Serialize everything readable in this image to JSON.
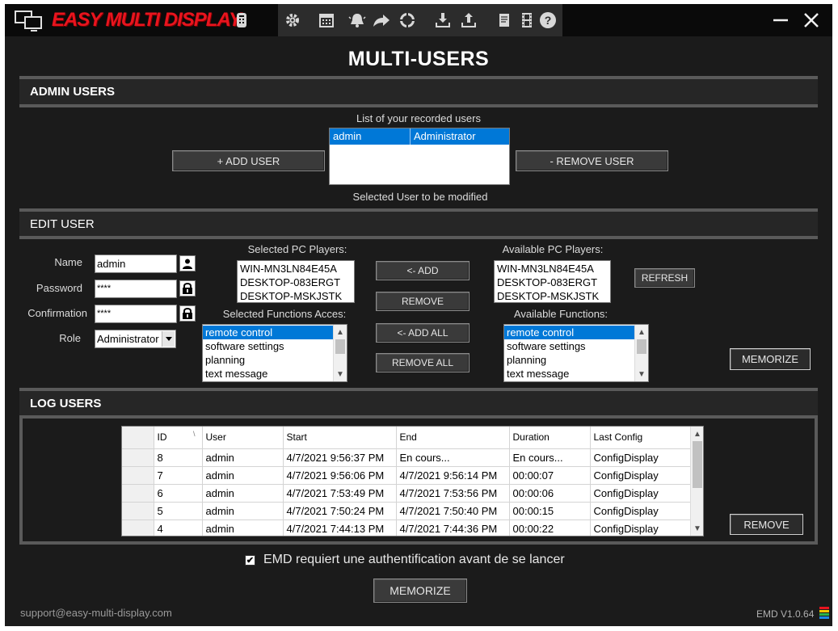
{
  "app": {
    "name": "EASY MULTI DISPLAY",
    "logo_color": "#e8141e"
  },
  "page": {
    "title": "MULTI-USERS"
  },
  "toolbar": {
    "icons": [
      "remote-icon",
      "gear-icon",
      "calendar-icon",
      "bell-icon",
      "share-icon",
      "lifebuoy-icon",
      "download-icon",
      "upload-icon",
      "notes-icon",
      "film-icon",
      "help-icon"
    ]
  },
  "admin": {
    "section_title": "ADMIN USERS",
    "list_title": "List of your recorded users",
    "users": [
      {
        "name": "admin",
        "role": "Administrator"
      }
    ],
    "add_button": "+ ADD USER",
    "remove_button": "- REMOVE USER",
    "selected_caption": "Selected User to be modified"
  },
  "edit": {
    "section_title": "EDIT USER",
    "name_label": "Name",
    "name_value": "admin",
    "password_label": "Password",
    "password_value": "****",
    "confirmation_label": "Confirmation",
    "confirmation_value": "****",
    "role_label": "Role",
    "role_value": "Administrator",
    "selected_players_label": "Selected PC Players:",
    "selected_players": [
      "WIN-MN3LN84E45A",
      "DESKTOP-083ERGT",
      "DESKTOP-MSKJSTK"
    ],
    "available_players_label": "Available PC Players:",
    "available_players": [
      "WIN-MN3LN84E45A",
      "DESKTOP-083ERGT",
      "DESKTOP-MSKJSTK"
    ],
    "selected_functions_label": "Selected Functions Acces:",
    "selected_functions": [
      "remote control",
      "software settings",
      "planning",
      "text message"
    ],
    "available_functions_label": "Available Functions:",
    "available_functions": [
      "remote control",
      "software settings",
      "planning",
      "text message"
    ],
    "add_button": "<- ADD",
    "remove_button": "REMOVE",
    "add_all_button": "<- ADD ALL",
    "remove_all_button": "REMOVE ALL",
    "refresh_button": "REFRESH",
    "memorize_button": "MEMORIZE"
  },
  "log": {
    "section_title": "LOG USERS",
    "columns": [
      "ID",
      "User",
      "Start",
      "End",
      "Duration",
      "Last Config"
    ],
    "rows": [
      {
        "id": "8",
        "user": "admin",
        "start": "4/7/2021 9:56:37 PM",
        "end": "En cours...",
        "duration": "En cours...",
        "config": "ConfigDisplay"
      },
      {
        "id": "7",
        "user": "admin",
        "start": "4/7/2021 9:56:06 PM",
        "end": "4/7/2021 9:56:14 PM",
        "duration": "00:00:07",
        "config": "ConfigDisplay"
      },
      {
        "id": "6",
        "user": "admin",
        "start": "4/7/2021 7:53:49 PM",
        "end": "4/7/2021 7:53:56 PM",
        "duration": "00:00:06",
        "config": "ConfigDisplay"
      },
      {
        "id": "5",
        "user": "admin",
        "start": "4/7/2021 7:50:24 PM",
        "end": "4/7/2021 7:50:40 PM",
        "duration": "00:00:15",
        "config": "ConfigDisplay"
      },
      {
        "id": "4",
        "user": "admin",
        "start": "4/7/2021 7:44:13 PM",
        "end": "4/7/2021 7:44:36 PM",
        "duration": "00:00:22",
        "config": "ConfigDisplay"
      }
    ],
    "remove_button": "REMOVE"
  },
  "auth": {
    "checkbox_label": "EMD requiert une authentification avant de se lancer",
    "checked": true,
    "memorize_button": "MEMORIZE"
  },
  "footer": {
    "email": "support@easy-multi-display.com",
    "version": "EMD V1.0.64"
  }
}
